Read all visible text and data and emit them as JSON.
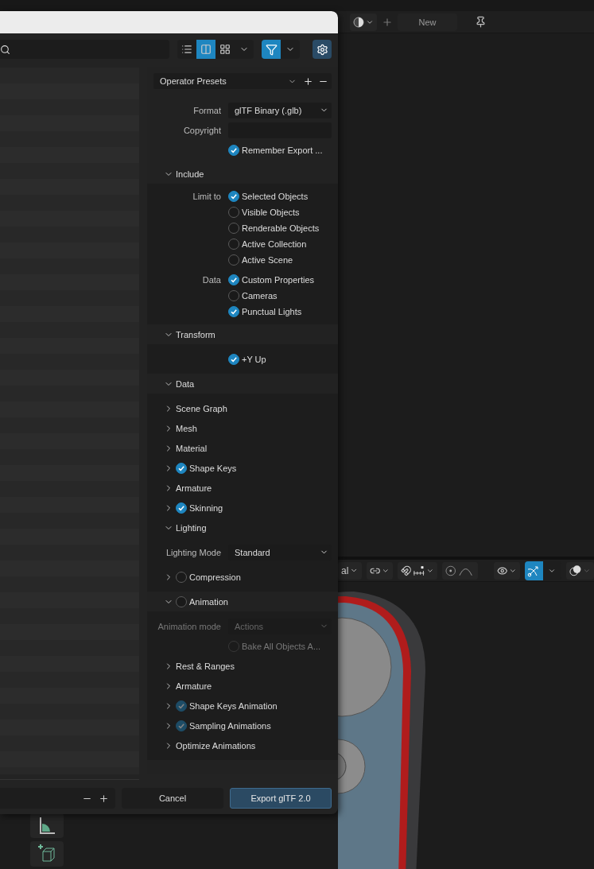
{
  "upper_header": {
    "new_label": "New"
  },
  "lower_header": {
    "pivot_label": "al",
    "gizmo_on": true
  },
  "dialog": {
    "view_modes": [
      {
        "selected": false
      },
      {
        "selected": true
      },
      {
        "selected": false
      }
    ],
    "filter_on": true,
    "presets": "Operator Presets",
    "rows": [
      {
        "kind": "select",
        "label": "Format",
        "value": "glTF Binary (.glb)"
      },
      {
        "kind": "text",
        "label": "Copyright"
      },
      {
        "kind": "check",
        "text": "Remember Export ...",
        "checked": true
      }
    ],
    "sections": [
      {
        "title": "Include",
        "expanded": true,
        "rows": [
          {
            "kind": "option",
            "label": "Limit to",
            "text": "Selected Objects",
            "checked": true
          },
          {
            "kind": "option",
            "text": "Visible Objects",
            "checked": false
          },
          {
            "kind": "option",
            "text": "Renderable Objects",
            "checked": false
          },
          {
            "kind": "option",
            "text": "Active Collection",
            "checked": false
          },
          {
            "kind": "option",
            "text": "Active Scene",
            "checked": false
          },
          {
            "kind": "option",
            "label": "Data",
            "text": "Custom Properties",
            "checked": true
          },
          {
            "kind": "option",
            "text": "Cameras",
            "checked": false
          },
          {
            "kind": "option",
            "text": "Punctual Lights",
            "checked": true
          }
        ]
      },
      {
        "title": "Transform",
        "expanded": true,
        "rows": [
          {
            "kind": "check",
            "text": "+Y Up",
            "checked": true
          }
        ]
      },
      {
        "title": "Data",
        "expanded": true,
        "children": [
          {
            "title": "Scene Graph",
            "expanded": false
          },
          {
            "title": "Mesh",
            "expanded": false
          },
          {
            "title": "Material",
            "expanded": false
          },
          {
            "title": "Shape Keys",
            "expanded": false,
            "checked": true
          },
          {
            "title": "Armature",
            "expanded": false
          },
          {
            "title": "Skinning",
            "expanded": false,
            "checked": true
          },
          {
            "title": "Lighting",
            "expanded": true,
            "rows": [
              {
                "kind": "select",
                "label": "Lighting Mode",
                "value": "Standard"
              }
            ]
          },
          {
            "title": "Compression",
            "expanded": false,
            "checked": false
          }
        ]
      },
      {
        "title": "Animation",
        "expanded": true,
        "checked": false,
        "rows": [
          {
            "kind": "select",
            "label": "Animation mode",
            "value": "Actions",
            "disabled": true
          },
          {
            "kind": "check",
            "text": "Bake All Objects A...",
            "checked": false,
            "disabled": true
          }
        ],
        "children": [
          {
            "title": "Rest & Ranges",
            "expanded": false
          },
          {
            "title": "Armature",
            "expanded": false
          },
          {
            "title": "Shape Keys Animation",
            "expanded": false,
            "checked": true,
            "disabled": true
          },
          {
            "title": "Sampling Animations",
            "expanded": false,
            "checked": true,
            "disabled": true
          },
          {
            "title": "Optimize Animations",
            "expanded": false
          }
        ]
      }
    ],
    "buttons": {
      "cancel": "Cancel",
      "export": "Export glTF 2.0"
    }
  }
}
